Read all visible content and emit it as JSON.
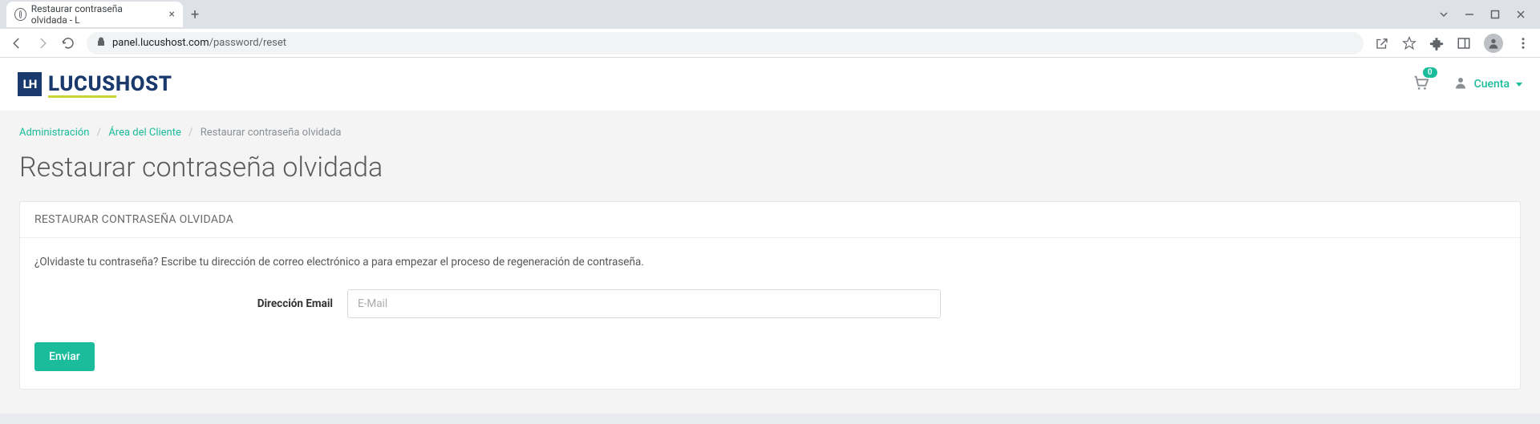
{
  "browser": {
    "tab_title": "Restaurar contraseña olvidada - L",
    "url_host": "panel.lucushost.com",
    "url_path": "/password/reset"
  },
  "header": {
    "logo_mark": "LH",
    "logo_text": "LUCUSHOST",
    "cart_count": "0",
    "account_label": "Cuenta"
  },
  "breadcrumb": {
    "items": [
      {
        "label": "Administración",
        "link": true
      },
      {
        "label": "Área del Cliente",
        "link": true
      },
      {
        "label": "Restaurar contraseña olvidada",
        "link": false
      }
    ]
  },
  "page": {
    "title": "Restaurar contraseña olvidada",
    "panel_header": "RESTAURAR CONTRASEÑA OLVIDADA",
    "description": "¿Olvidaste tu contraseña? Escribe tu dirección de correo electrónico a para empezar el proceso de regeneración de contraseña.",
    "email_label": "Dirección Email",
    "email_placeholder": "E-Mail",
    "submit_label": "Enviar"
  }
}
